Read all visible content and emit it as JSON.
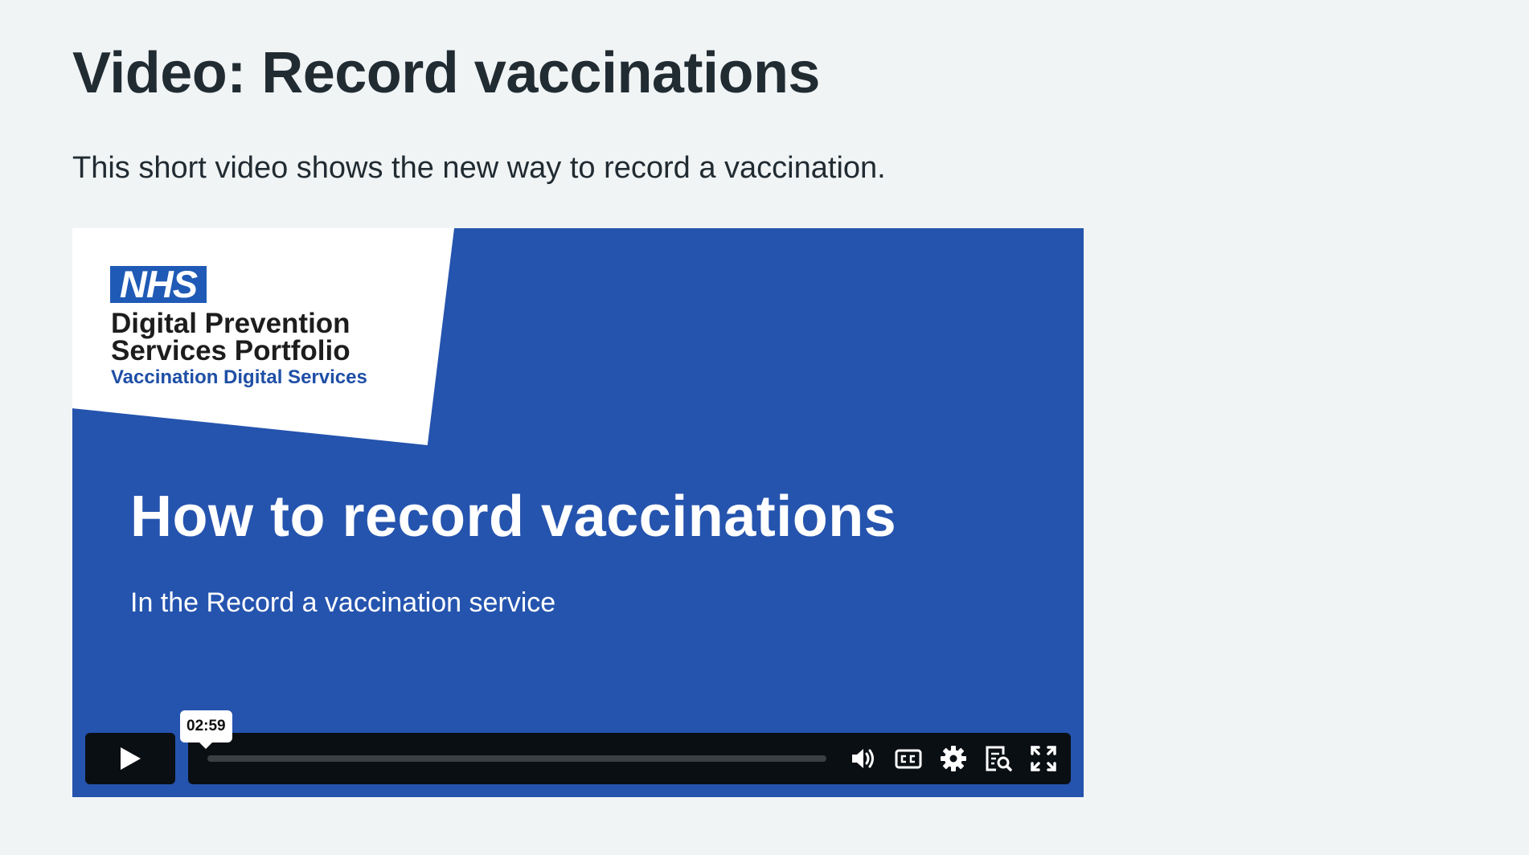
{
  "page": {
    "title": "Video: Record vaccinations",
    "intro": "This short video shows the new way to record a vaccination."
  },
  "video": {
    "brand": {
      "logo": "NHS",
      "line1": "Digital Prevention",
      "line2": "Services Portfolio",
      "line3": "Vaccination Digital Services"
    },
    "title": "How to record vaccinations",
    "subtitle": "In the Record a vaccination service",
    "controls": {
      "time_tooltip": "02:59",
      "icons": [
        "play-icon",
        "volume-icon",
        "captions-icon",
        "settings-icon",
        "transcript-icon",
        "fullscreen-icon"
      ]
    }
  },
  "colors": {
    "page_background": "#f0f4f5",
    "video_background": "#2554ae",
    "nhs_blue": "#1f5ab6",
    "control_bar": "#0a0f14"
  }
}
